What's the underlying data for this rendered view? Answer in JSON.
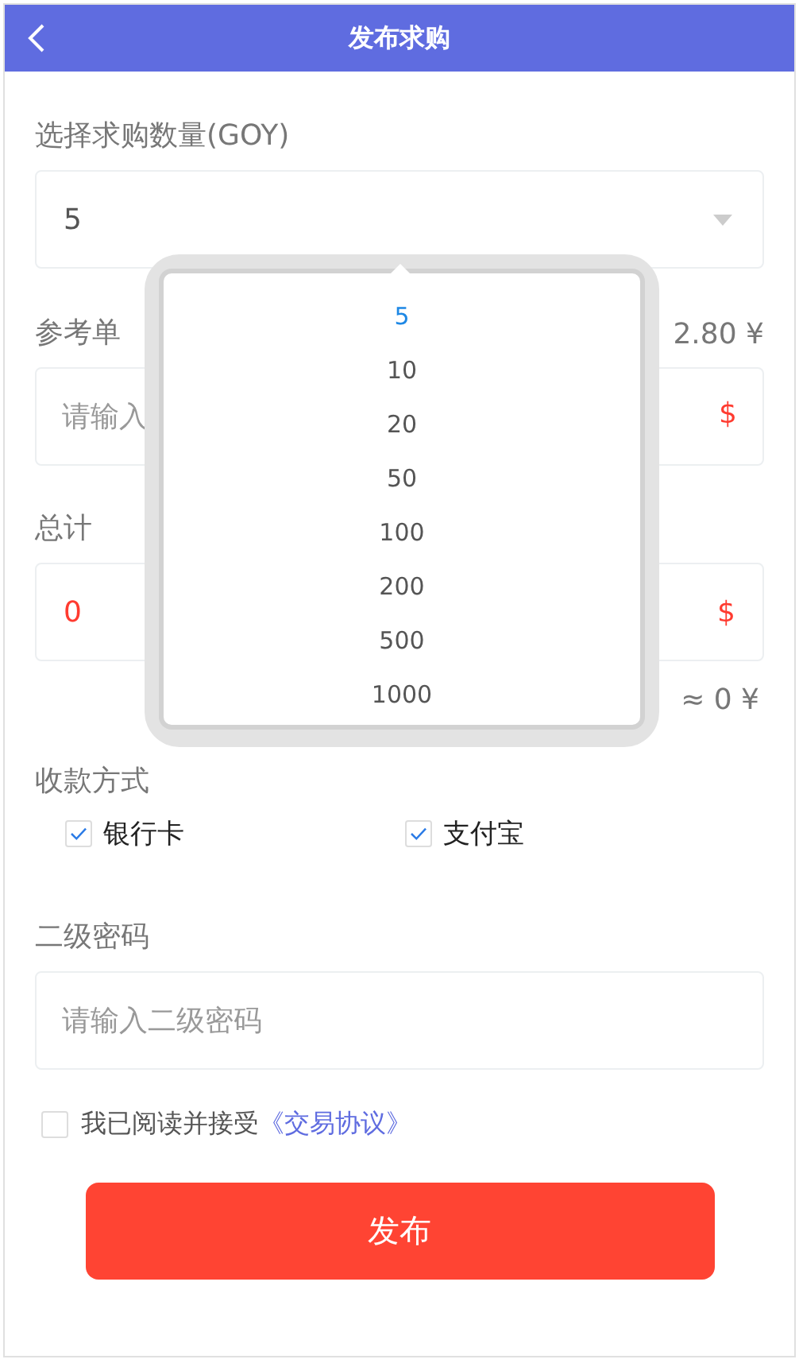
{
  "header": {
    "title": "发布求购"
  },
  "quantity": {
    "label": "选择求购数量(GOY)",
    "value": "5",
    "open": true,
    "options": [
      {
        "label": "5",
        "selected": true
      },
      {
        "label": "10",
        "selected": false
      },
      {
        "label": "20",
        "selected": false
      },
      {
        "label": "50",
        "selected": false
      },
      {
        "label": "100",
        "selected": false
      },
      {
        "label": "200",
        "selected": false
      },
      {
        "label": "500",
        "selected": false
      },
      {
        "label": "1000",
        "selected": false
      }
    ]
  },
  "unit_price": {
    "label": "参考单",
    "approx": "2.80 ¥",
    "placeholder": "请输入",
    "currency": "$"
  },
  "total": {
    "label": "总计",
    "value": "0",
    "currency": "$",
    "approx": "≈ 0 ¥"
  },
  "payment": {
    "label": "收款方式",
    "methods": [
      {
        "label": "银行卡",
        "checked": true
      },
      {
        "label": "支付宝",
        "checked": true
      }
    ]
  },
  "password": {
    "label": "二级密码",
    "placeholder": "请输入二级密码"
  },
  "agreement": {
    "checked": false,
    "text": "我已阅读并接受",
    "link": "《交易协议》"
  },
  "submit": "发布"
}
